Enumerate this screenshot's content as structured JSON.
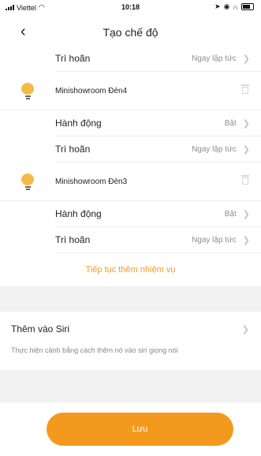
{
  "status_bar": {
    "carrier": "Viettel",
    "time": "10:18"
  },
  "nav": {
    "back_icon": "chevron-left-icon",
    "title": "Tạo chế độ"
  },
  "task_rows": {
    "top_delay": {
      "label": "Trì hoãn",
      "value": "Ngay lập tức"
    },
    "device1": {
      "name": "Minishowroom Đèn4",
      "icon": "bulb-icon"
    },
    "device1_action": {
      "label": "Hành động",
      "value": "Bật"
    },
    "device1_delay": {
      "label": "Trì hoãn",
      "value": "Ngay lập tức"
    },
    "device2": {
      "name": "Minishowroom Đèn3",
      "icon": "bulb-icon"
    },
    "device2_action": {
      "label": "Hành động",
      "value": "Bật"
    },
    "device2_delay": {
      "label": "Trì hoãn",
      "value": "Ngay lập tức"
    }
  },
  "add_task_label": "Tiếp tục thêm nhiệm vụ",
  "siri": {
    "label": "Thêm vào Siri",
    "note": "Thực hiện cảnh bằng cách thêm nó vào siri giọng nói"
  },
  "save_label": "Lưu",
  "colors": {
    "accent": "#f39a1e",
    "bulb": "#f5b945",
    "muted_text": "#8e8e8e",
    "section_bg": "#f1f1f1"
  }
}
